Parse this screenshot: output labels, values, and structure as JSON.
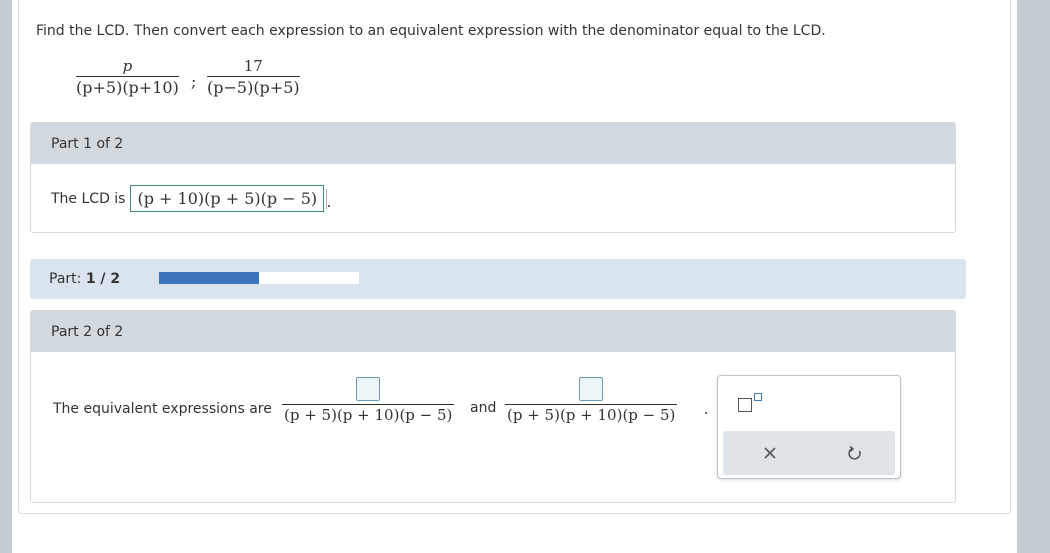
{
  "question": {
    "text": "Find the LCD. Then convert each expression to an equivalent expression with the denominator equal to the LCD.",
    "expressions": [
      {
        "numerator": "p",
        "denominator": "(p+5)(p+10)"
      },
      {
        "numerator": "17",
        "denominator": "(p−5)(p+5)"
      }
    ],
    "separator": ";"
  },
  "part1": {
    "header": "Part 1 of 2",
    "lcd_label": "The LCD is",
    "lcd_answer": "(p + 10)(p + 5)(p − 5)"
  },
  "progress": {
    "label": "Part:",
    "current": "1 / 2",
    "fraction": 0.5,
    "fill_color": "#3b74b8"
  },
  "part2": {
    "header": "Part 2 of 2",
    "equiv_label": "The equivalent expressions are",
    "denominator1": "(p + 5)(p + 10)(p − 5)",
    "denominator2": "(p + 5)(p + 10)(p − 5)",
    "and_label": "and",
    "numerator1_value": "",
    "numerator2_value": ""
  },
  "toolbar": {
    "icons": [
      "fraction-template-icon",
      "clear-icon",
      "undo-icon"
    ]
  },
  "colors": {
    "header_bg": "#d2d9de",
    "progress_strip_bg": "#d9e4ef",
    "answer_border": "#3a8c74",
    "input_border": "#6c9bb7"
  }
}
